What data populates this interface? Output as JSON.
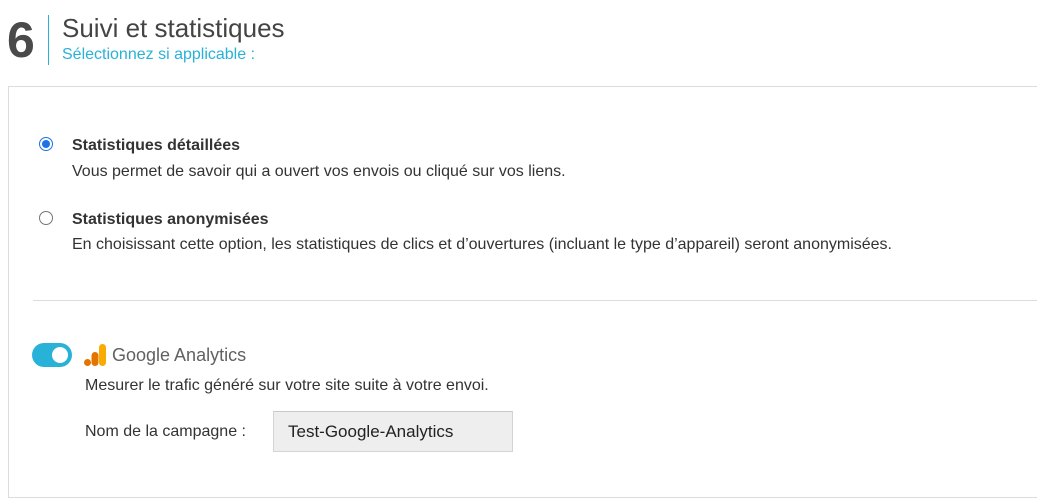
{
  "step": {
    "number": "6",
    "title": "Suivi et statistiques",
    "subtitle": "Sélectionnez si applicable :"
  },
  "statistics_options": [
    {
      "title": "Statistiques détaillées",
      "description": "Vous permet de savoir qui a ouvert vos envois ou cliqué sur vos liens.",
      "selected": true
    },
    {
      "title": "Statistiques anonymisées",
      "description": "En choisissant cette option, les statistiques de clics et d’ouvertures (incluant le type d’appareil) seront anonymisées.",
      "selected": false
    }
  ],
  "google_analytics": {
    "enabled": true,
    "brand_name": "Google Analytics",
    "logo_icon": "google-analytics-icon",
    "description": "Mesurer le trafic généré sur votre site suite à votre envoi.",
    "campaign_label": "Nom de la campagne :",
    "campaign_value": "Test-Google-Analytics"
  },
  "colors": {
    "accent": "#29b2d8",
    "radio_selected": "#1a73e8",
    "ga_orange": "#f9ab00",
    "ga_dark_orange": "#e37400"
  }
}
